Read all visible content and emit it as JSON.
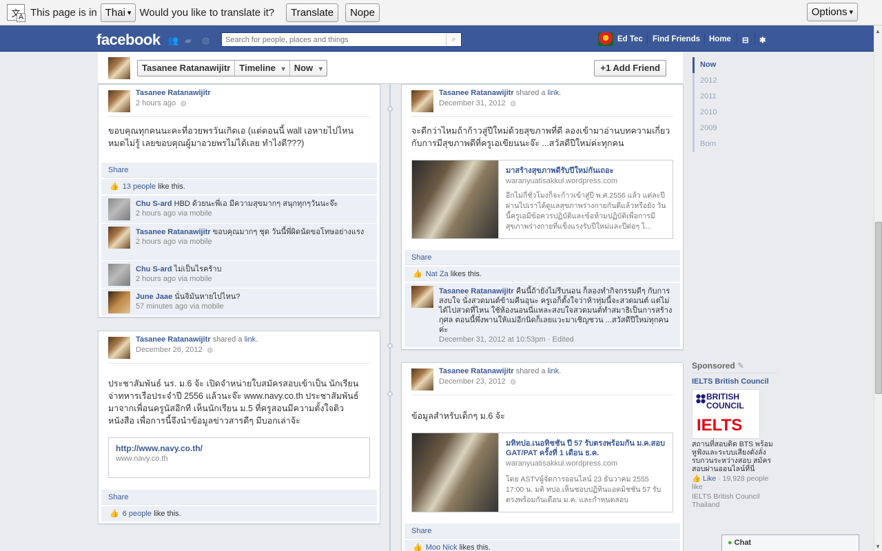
{
  "translate_bar": {
    "prefix": "This page is in",
    "language": "Thai",
    "question": "Would you like to translate it?",
    "translate_label": "Translate",
    "nope_label": "Nope",
    "options_label": "Options"
  },
  "header": {
    "logo": "facebook",
    "search_placeholder": "Search for people, places and things",
    "user_name": "Ed Tec",
    "find_friends": "Find Friends",
    "home": "Home"
  },
  "timeline_header": {
    "profile_name": "Tasanee Ratanawijitr",
    "timeline_label": "Timeline",
    "now_label": "Now",
    "add_friend_label": "Add Friend"
  },
  "years": [
    "Now",
    "2012",
    "2011",
    "2010",
    "2009",
    "Born"
  ],
  "posts": {
    "p1": {
      "author": "Tasanee Ratanawijitr",
      "time": "2 hours ago",
      "text": "ขอบคุณทุกคนนะคะที่อวยพรวันเกิดเอ (แต่ตอนนี้ wall เอหายไปไหน หมดไม่รู้ เลยขอบคุณผู้มาอวยพรไม่ได้เลย ทำไงดี???)",
      "share": "Share",
      "likes_count": "13 people",
      "likes_suffix": "like this.",
      "comments": [
        {
          "author": "Chu S-ard",
          "text": "HBD ด้วยนะพี่เอ มีความสุขมากๆ สนุกทุกๆวันนะจ๊ะ",
          "meta": "2 hours ago via mobile"
        },
        {
          "author": "Tasanee Ratanawijitr",
          "text": "ขอบคุณมากๆ ชุด วันนี้พี่ผิดนัดขอโทษอย่างแรง",
          "meta": "2 hours ago via mobile"
        },
        {
          "author": "Chu S-ard",
          "text": "ไม่เป็นไรคร้าบ",
          "meta": "2 hours ago via mobile"
        },
        {
          "author": "June Jaae",
          "text": "นั่นจิมันหายไปไหน?",
          "meta": "57 minutes ago via mobile"
        }
      ]
    },
    "p2": {
      "author": "Tasanee Ratanawijitr",
      "shared": "shared a",
      "link_word": "link.",
      "time": "December 26, 2012",
      "text": "ประชาสัมพันธ์ นร. ม.6 จ้ะ เปิดจำหน่ายใบสมัครสอบเข้าเป็น นักเรียนจ่าทหารเรือประจำปี 2556 แล้วนะจ๊ะ www.navy.co.th ประชาสัมพันธ์มาจากเพื่อนครูนัสอีกที เห็นนักเรียน ม.5 ที่ครูสอนมีความตั้งใจติวหนังสือ เพื่อการนี้จึงนำข้อมูลข่าวสารดีๆ มีบอกเล่าจ้ะ",
      "card_title": "http://www.navy.co.th/",
      "card_url": "www.navy.co.th",
      "share": "Share",
      "likes_count": "6 people",
      "likes_suffix": "like this."
    },
    "p3": {
      "author": "Tasanee Ratanawijitr",
      "shared": "shared a",
      "link_word": "link.",
      "time": "December 31, 2012",
      "text": "จะดีกว่าไหมถ้าก้าวสู่ปีใหม่ด้วยสุขภาพที่ดี ลองเข้ามาอ่านบทความเกี่ยวกับการมีสุขภาพดีที่ครูเอเขียนนะจ๊ะ ...สวัสดีปีใหม่ค่ะทุกคน",
      "card_title": "มาสร้างสุขภาพดีรับปีใหม่กันเถอะ",
      "card_url": "waranyuatisakkul.wordpress.com",
      "card_desc": "อีกไม่กี่ชั่วโมงก็จะก้าวเข้าสู่ปี พ.ศ.2556 แล้ว แต่ละปีผ่านไปเราได้ดูแลสุขภาพร่างกายกันดีแล้วหรือยัง วันนี้ครูเอมีข้อควรปฏิบัติและข้อห้ามปฏิบัติเพื่อการมีสุขภาพร่างกายที่แข็งแรงรับปีใหม่และปีต่อๆ ไ...",
      "share": "Share",
      "liker": "Nat Za",
      "likes_suffix": "likes this.",
      "comment_author": "Tasanee Ratanawijitr",
      "comment_text": "คืนนี้ถ้ายังไม่รีบนอน ก็ลองทำกิจกรรมดีๆ กับการสงบใจ นั่งสวดมนต์ข้ามคืนอุนะ ครูเอก็ตั้งใจว่าห้าทุ่มนี้จะสวดมนต์ แต่ไม่ได้ไปสวดที่ไหน ใช้ห้องนอนนี่แหละสงบใจสวดมนต์ทำสมาธิเป็นการสร้างกุศล ตอนนี้พึ่งพานให้แม่อีกนิดก็เลยแวะมาเชิญชวน ...สวัสดีปีใหม่ทุกคนค่ะ",
      "comment_meta": "December 31, 2012 at 10:53pm · Edited"
    },
    "p4": {
      "author": "Tasanee Ratanawijitr",
      "shared": "shared a",
      "link_word": "link.",
      "time": "December 23, 2012",
      "text": "ข้อมูลสำหรับเด็กๆ ม.6 จ้ะ",
      "card_title": "มหิทปอ.เนอทิชชัน ปี 57 รับตรงพร้อมกัน ม.ค.สอบ GAT/PAT ครั้งที่ 1 เดือน ธ.ค.",
      "card_url": "waranyuatisakkul.wordpress.com",
      "card_desc": "โดย ASTVผู้จัดการออนไลน์ 23 ธันวาคม 2555 17:00 น. มติ ทปอ.เห็นชอบปฏิทินแอดมิชชัน 57 รับตรงพร้อมกันเดือน ม.ค. และกำหนดสอบ",
      "share": "Share",
      "liker": "Moo Nick",
      "likes_suffix": "likes this."
    }
  },
  "sponsored": {
    "heading": "Sponsored",
    "ad_title": "IELTS British Council",
    "logo_top": "BRITISH COUNCIL",
    "logo_bottom": "IELTS",
    "ad_desc": "สถานที่สอบติด BTS พร้อมหูฟังและระบบเสียงดังลั่ง รบกวนระหว่างสอบ สมัครสอบผ่านออนไลน์ที่นี่",
    "like_label": "Like",
    "likes_count": "· 19,928 people like",
    "source": "IELTS British Council Thailand"
  },
  "chat": {
    "label": "Chat"
  },
  "icons": {
    "friend_requests": "friends-icon",
    "messages": "messages-icon",
    "notifications": "globe-icon",
    "privacy": "lock-icon",
    "settings": "gear-icon"
  }
}
